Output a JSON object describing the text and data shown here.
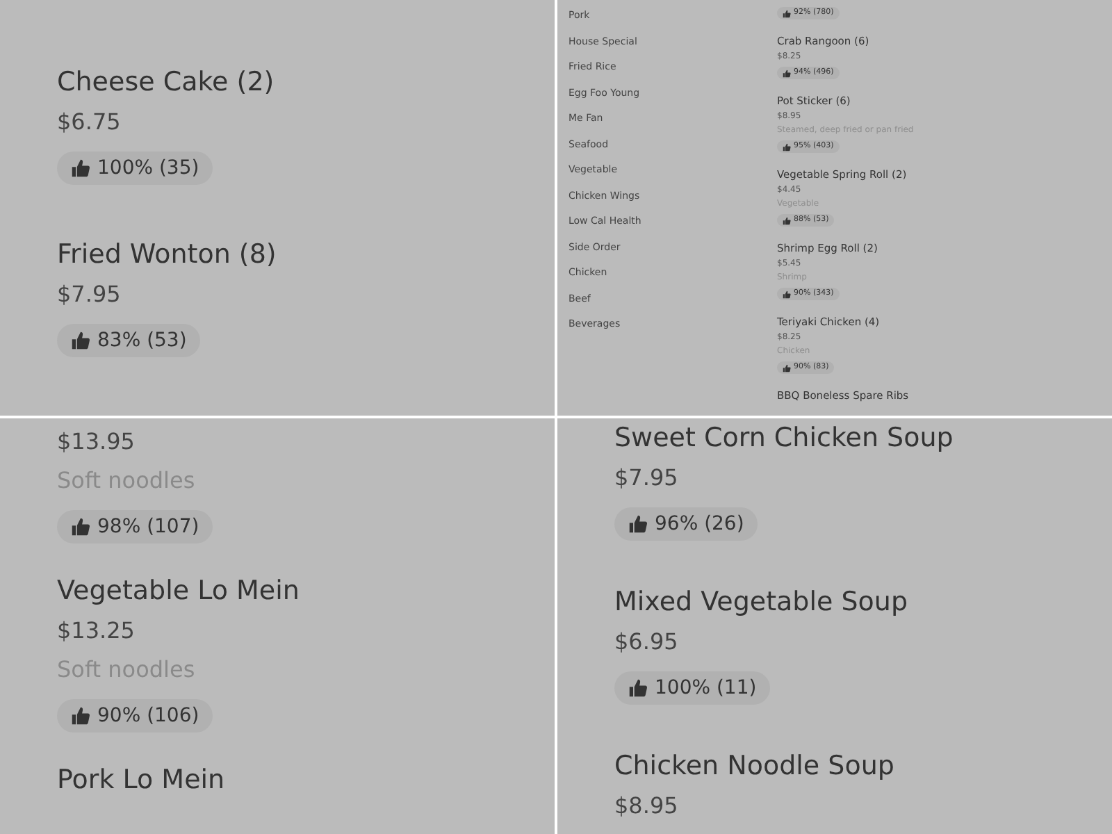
{
  "panels": [
    {
      "kind": "menu",
      "items": [
        {
          "name": "Cheese Cake (2)",
          "price": "$6.75",
          "rating": "100% (35)"
        },
        {
          "name": "Fried Wonton (8)",
          "price": "$7.95",
          "rating": "83% (53)"
        }
      ]
    },
    {
      "kind": "sidebar_menu",
      "categories": [
        "Pork",
        "House Special",
        "Fried Rice",
        "Egg Foo Young",
        "Me Fan",
        "Seafood",
        "Vegetable",
        "Chicken Wings",
        "Low Cal Health",
        "Side Order",
        "Chicken",
        "Beef",
        "Beverages"
      ],
      "items": [
        {
          "rating": "92% (780)"
        },
        {
          "name": "Crab Rangoon (6)",
          "price": "$8.25",
          "rating": "94% (496)"
        },
        {
          "name": "Pot Sticker (6)",
          "price": "$8.95",
          "description": "Steamed, deep fried or pan fried",
          "rating": "95% (403)"
        },
        {
          "name": "Vegetable Spring Roll (2)",
          "price": "$4.45",
          "description": "Vegetable",
          "rating": "88% (53)"
        },
        {
          "name": "Shrimp Egg Roll (2)",
          "price": "$5.45",
          "description": "Shrimp",
          "rating": "90% (343)"
        },
        {
          "name": "Teriyaki Chicken (4)",
          "price": "$8.25",
          "description": "Chicken",
          "rating": "90% (83)"
        },
        {
          "name": "BBQ Boneless Spare Ribs"
        }
      ]
    },
    {
      "kind": "menu",
      "items": [
        {
          "price": "$13.95",
          "description": "Soft noodles",
          "rating": "98% (107)"
        },
        {
          "name": "Vegetable Lo Mein",
          "price": "$13.25",
          "description": "Soft noodles",
          "rating": "90% (106)"
        },
        {
          "name": "Pork Lo Mein"
        }
      ]
    },
    {
      "kind": "menu",
      "items": [
        {
          "name": "Sweet Corn Chicken Soup",
          "price": "$7.95",
          "rating": "96% (26)"
        },
        {
          "name": "Mixed Vegetable Soup",
          "price": "$6.95",
          "rating": "100% (11)"
        },
        {
          "name": "Chicken Noodle Soup",
          "price": "$8.95"
        }
      ]
    }
  ]
}
